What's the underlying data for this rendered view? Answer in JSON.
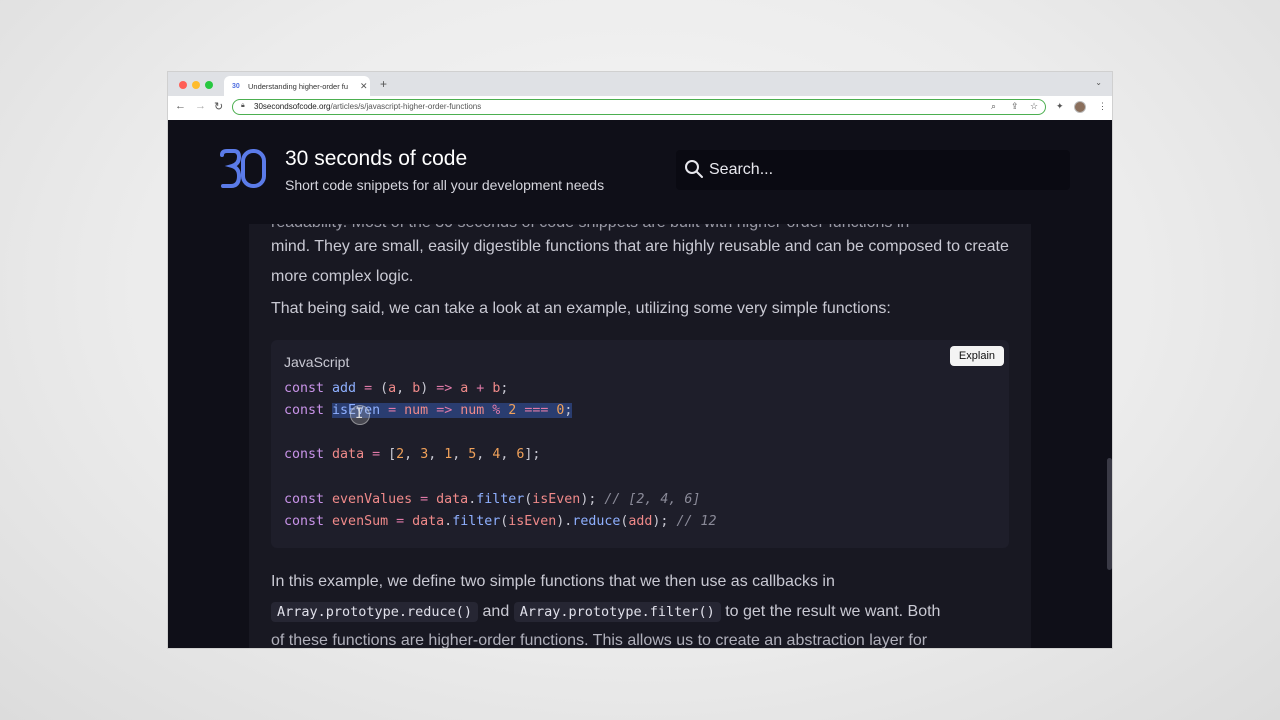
{
  "browser": {
    "tab_title": "Understanding higher-order fu",
    "tab_favicon": "30",
    "url_host": "30secondsofcode.org",
    "url_path": "/articles/s/javascript-higher-order-functions",
    "icons": [
      "back-icon",
      "forward-icon",
      "reload-icon",
      "lock-icon",
      "zoom-icon",
      "share-icon",
      "bookmark-star-icon",
      "extensions-icon",
      "profile-avatar",
      "menu-kebab-icon"
    ]
  },
  "site": {
    "title": "30 seconds of code",
    "subtitle": "Short code snippets for all your development needs",
    "search_placeholder": "Search...",
    "logo_text": "30"
  },
  "article": {
    "cut_line": "readability. Most of the 30 seconds of code snippets are built with higher-order functions in",
    "para1": "mind. They are small, easily digestible functions that are highly reusable and can be composed to create more complex logic.",
    "para2": "That being said, we can take a look at an example, utilizing some very simple functions:",
    "code": {
      "language": "JavaScript",
      "explain_label": "Explain",
      "lines": [
        "const add = (a, b) => a + b;",
        "const isEven = num => num % 2 === 0;",
        "",
        "const data = [2, 3, 1, 5, 4, 6];",
        "",
        "const evenValues = data.filter(isEven); // [2, 4, 6]",
        "const evenSum = data.filter(isEven).reduce(add); // 12"
      ]
    },
    "para3": "In this example, we define two simple functions that we then use as callbacks in",
    "inline_code_1": "Array.prototype.reduce()",
    "para4_mid": "and",
    "inline_code_2": "Array.prototype.filter()",
    "para4_end": "to get the result we want. Both",
    "para5_cut": "of these functions are higher-order functions. This allows us to create an abstraction layer for"
  },
  "colors": {
    "page_bg": "#0f0f18",
    "article_bg": "#181822",
    "code_bg": "#1e1e2a",
    "accent": "#4f6ee0",
    "selection": "#2a3d70"
  }
}
